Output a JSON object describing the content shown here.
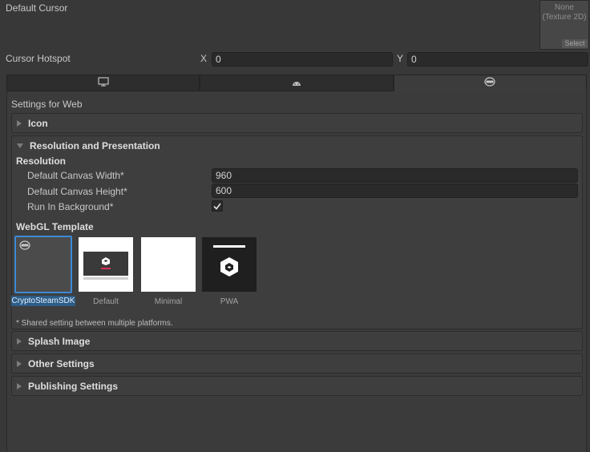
{
  "cursor": {
    "default_cursor_label": "Default Cursor",
    "texture_none": "None",
    "texture_type": "(Texture 2D)",
    "select_label": "Select",
    "hotspot_label": "Cursor Hotspot",
    "x_label": "X",
    "x_value": "0",
    "y_label": "Y",
    "y_value": "0"
  },
  "tabs": [
    {
      "icon": "monitor-icon",
      "active": false
    },
    {
      "icon": "android-icon",
      "active": false
    },
    {
      "icon": "webgl-icon",
      "active": true
    }
  ],
  "settings_header": "Settings for Web",
  "sections": {
    "icon": "Icon",
    "resolution": "Resolution and Presentation",
    "splash": "Splash Image",
    "other": "Other Settings",
    "publishing": "Publishing Settings"
  },
  "resolution": {
    "heading": "Resolution",
    "canvas_width_label": "Default Canvas Width*",
    "canvas_width_value": "960",
    "canvas_height_label": "Default Canvas Height*",
    "canvas_height_value": "600",
    "run_bg_label": "Run In Background*",
    "run_bg_checked": true
  },
  "webgl": {
    "heading": "WebGL Template",
    "templates": [
      {
        "name": "CryptoSteamSDK",
        "selected": true
      },
      {
        "name": "Default",
        "selected": false
      },
      {
        "name": "Minimal",
        "selected": false
      },
      {
        "name": "PWA",
        "selected": false
      }
    ],
    "shared_note": "* Shared setting between multiple platforms."
  },
  "colors": {
    "selection": "#2c5d87",
    "selected_border": "#3b8ad8"
  }
}
